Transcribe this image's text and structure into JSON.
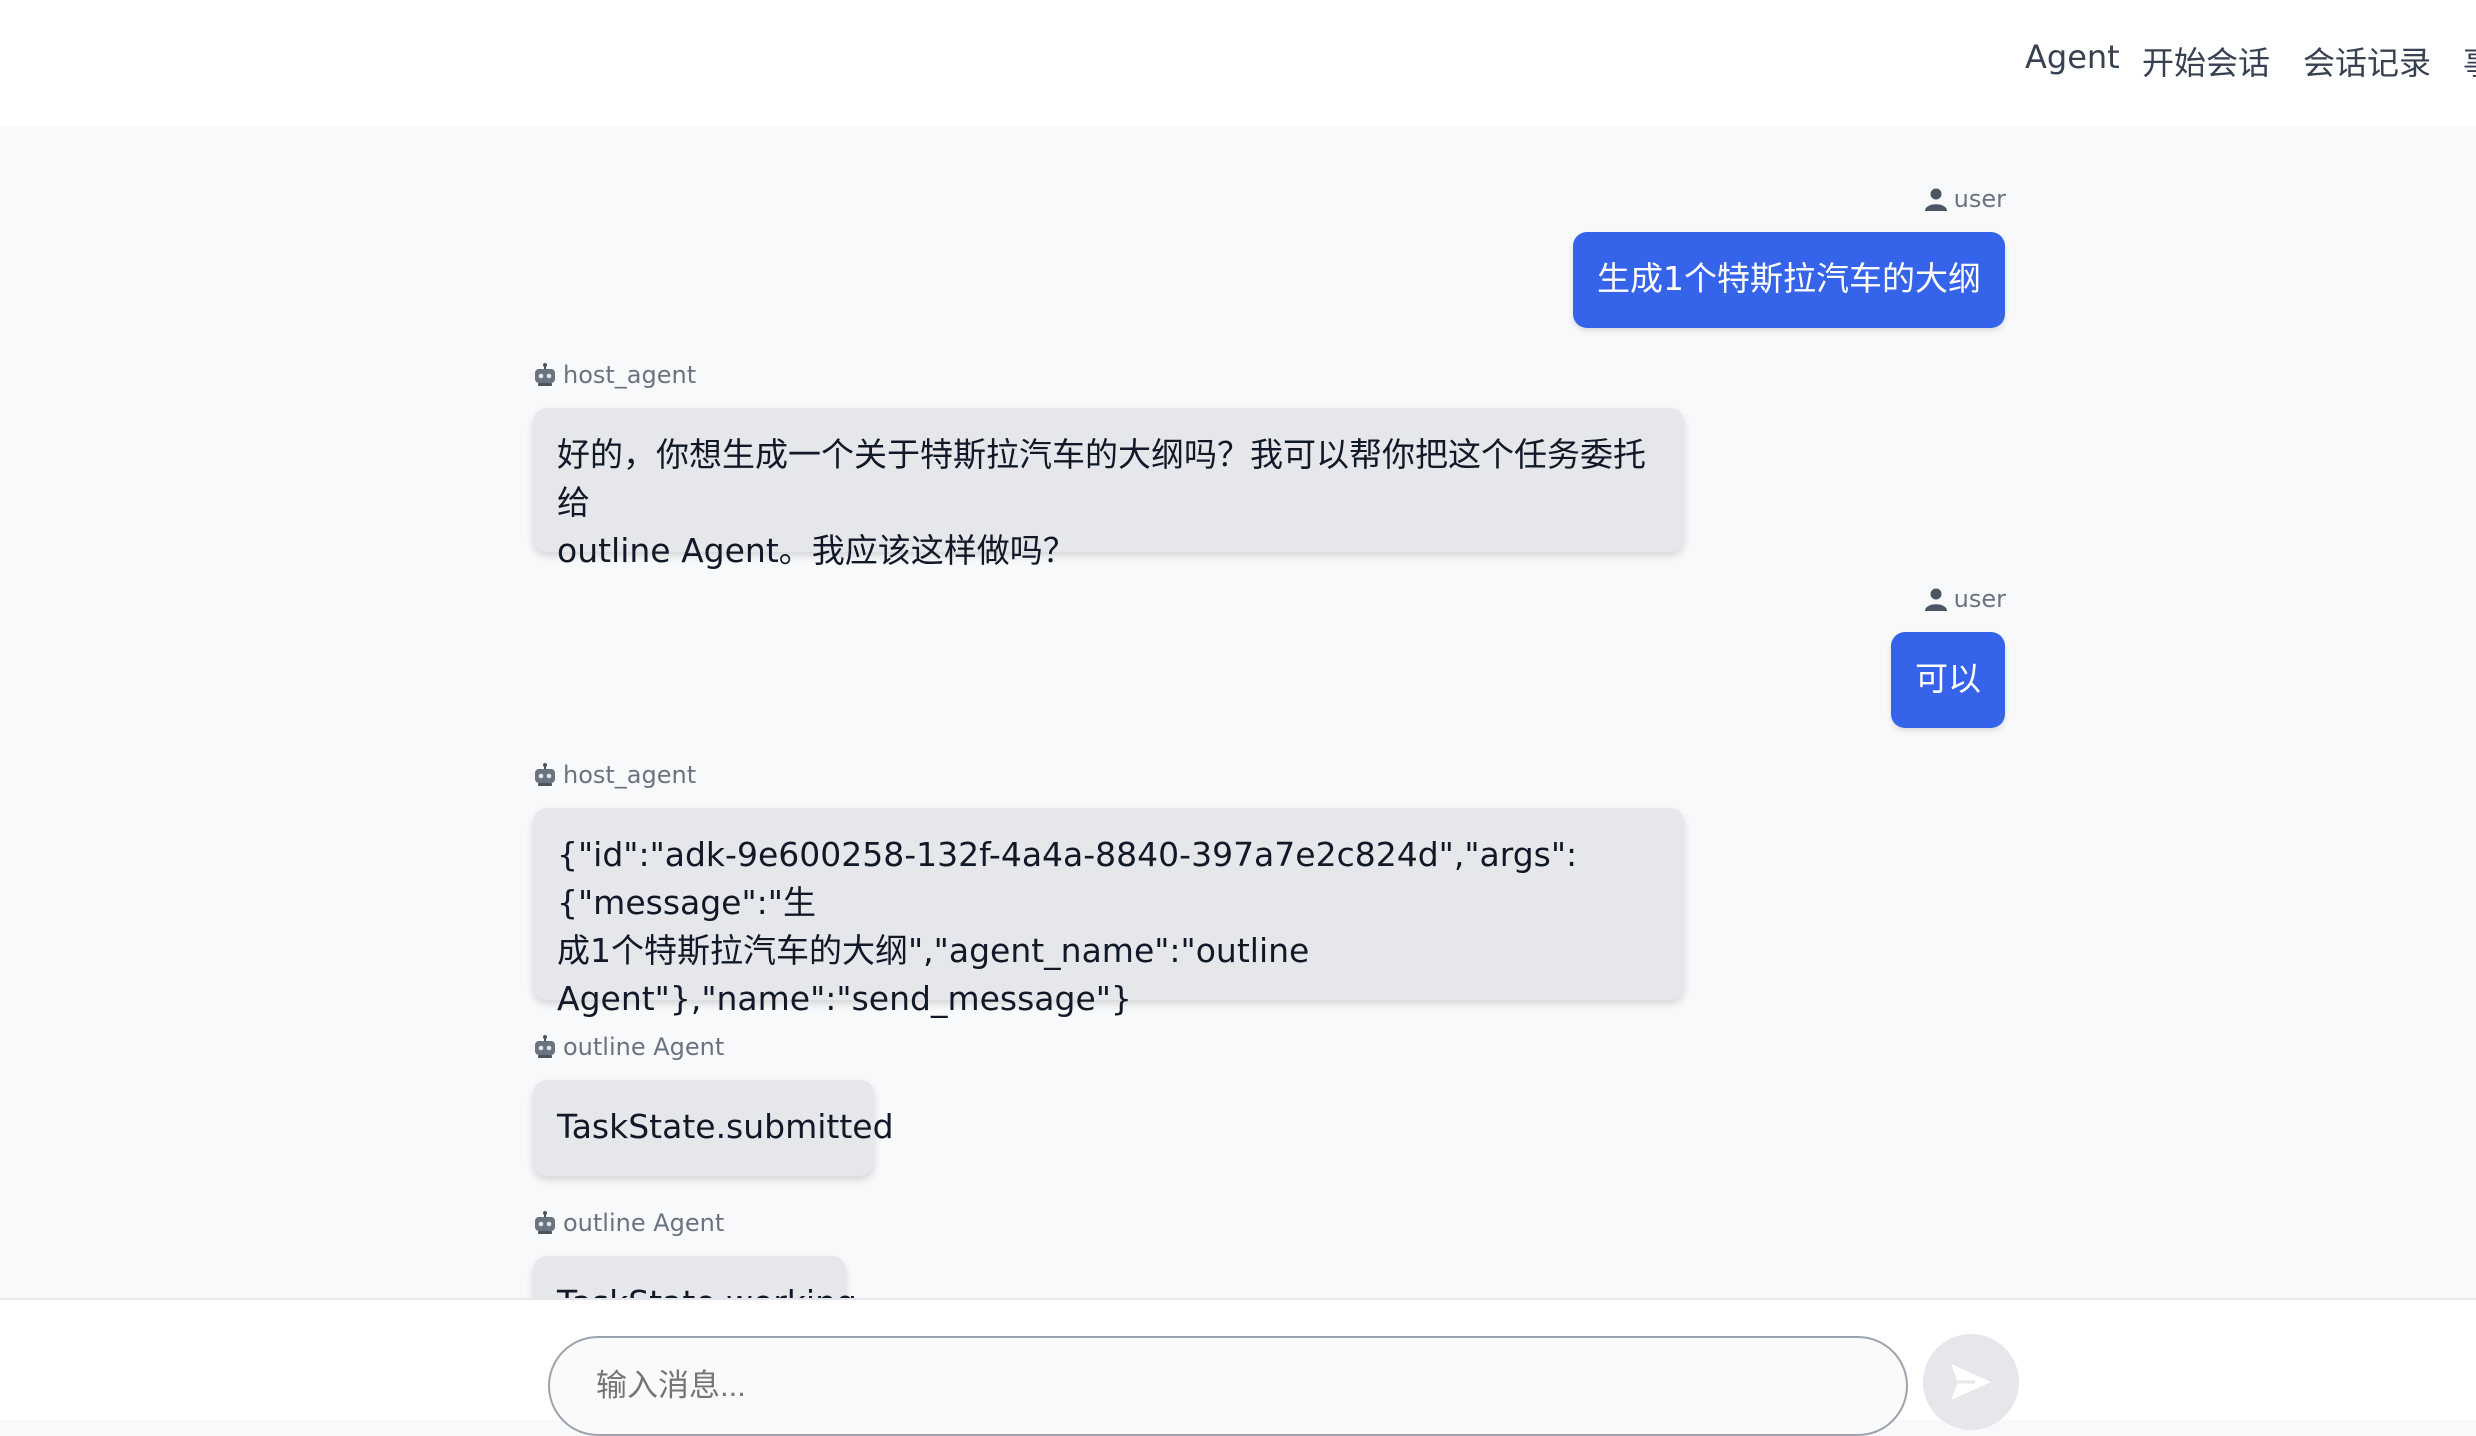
{
  "nav": {
    "items": [
      "Agent",
      "开始会话",
      "会话记录",
      "事"
    ]
  },
  "messages": [
    {
      "role": "user",
      "sender": "user",
      "icon": "user-icon",
      "text": "生成1个特斯拉汽车的大纲"
    },
    {
      "role": "agent",
      "sender": "host_agent",
      "icon": "robot-icon",
      "lines": [
        "好的，你想生成一个关于特斯拉汽车的大纲吗？我可以帮你把这个任务委托给",
        "outline Agent。我应该这样做吗？"
      ]
    },
    {
      "role": "user",
      "sender": "user",
      "icon": "user-icon",
      "text": "可以"
    },
    {
      "role": "agent",
      "sender": "host_agent",
      "icon": "robot-icon",
      "lines": [
        "{\"id\":\"adk-9e600258-132f-4a4a-8840-397a7e2c824d\",\"args\":{\"message\":\"生",
        "成1个特斯拉汽车的大纲\",\"agent_name\":\"outline",
        "Agent\"},\"name\":\"send_message\"}"
      ]
    },
    {
      "role": "agent",
      "sender": "outline Agent",
      "icon": "robot-icon",
      "text": "TaskState.submitted"
    },
    {
      "role": "agent",
      "sender": "outline Agent",
      "icon": "robot-icon",
      "text": "TaskState.working"
    }
  ],
  "composer": {
    "placeholder": "输入消息...",
    "send_icon": "send-icon"
  },
  "colors": {
    "user_bubble": "#3563e9",
    "agent_bubble": "#e5e7eb",
    "background": "#f8f9fb"
  }
}
